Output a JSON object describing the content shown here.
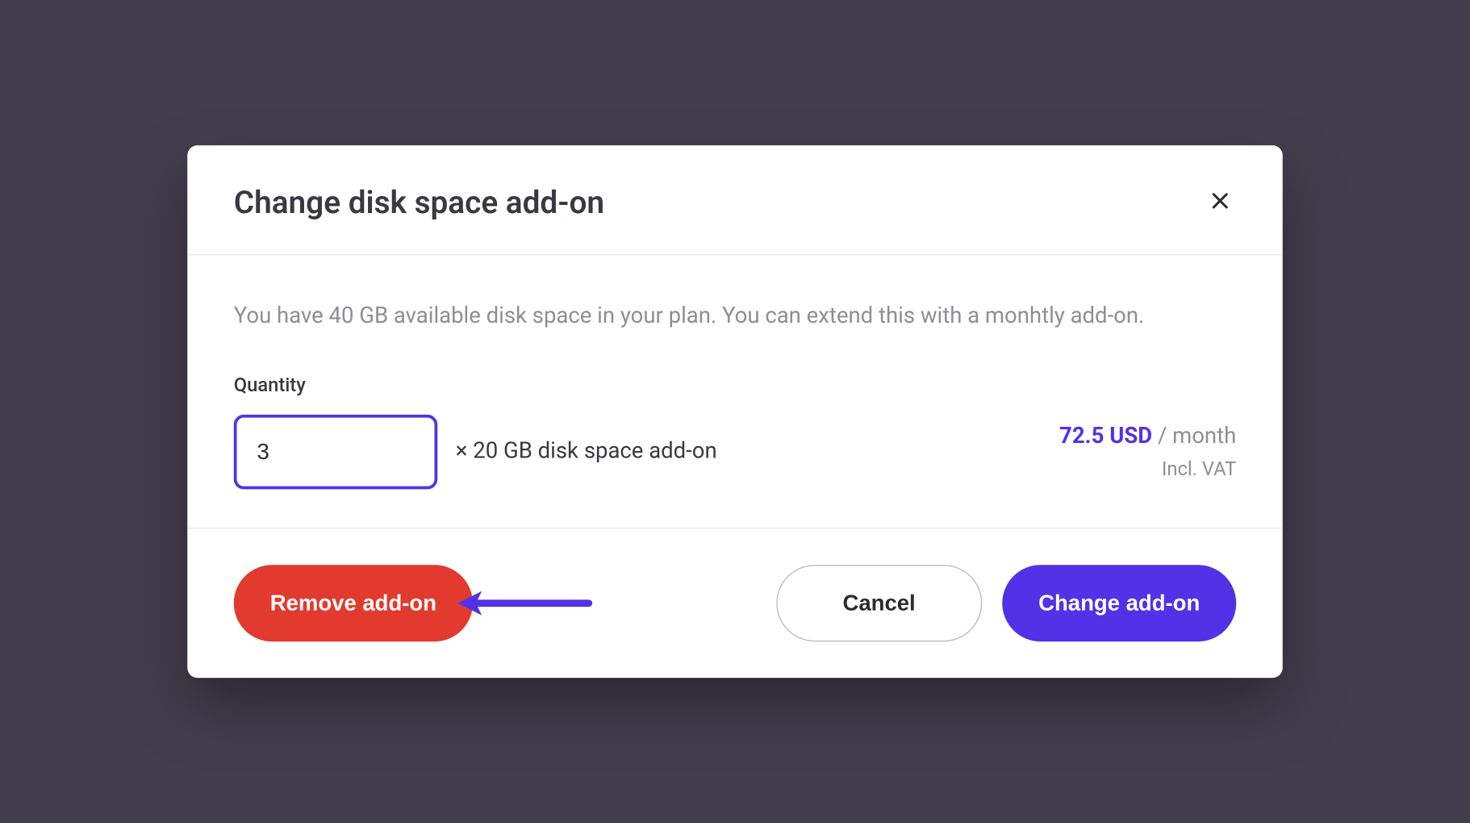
{
  "modal": {
    "title": "Change disk space add-on",
    "description": "You have 40 GB available disk space in your plan. You can extend this with a monhtly add-on.",
    "quantity_label": "Quantity",
    "quantity_value": "3",
    "addon_suffix": "× 20 GB disk space add-on",
    "price_amount": "72.5 USD",
    "price_per": " / month",
    "price_note": "Incl. VAT",
    "buttons": {
      "remove": "Remove add-on",
      "cancel": "Cancel",
      "confirm": "Change add-on"
    }
  },
  "colors": {
    "background": "#433e4c",
    "accent": "#5232e6",
    "danger": "#e23a2e"
  }
}
